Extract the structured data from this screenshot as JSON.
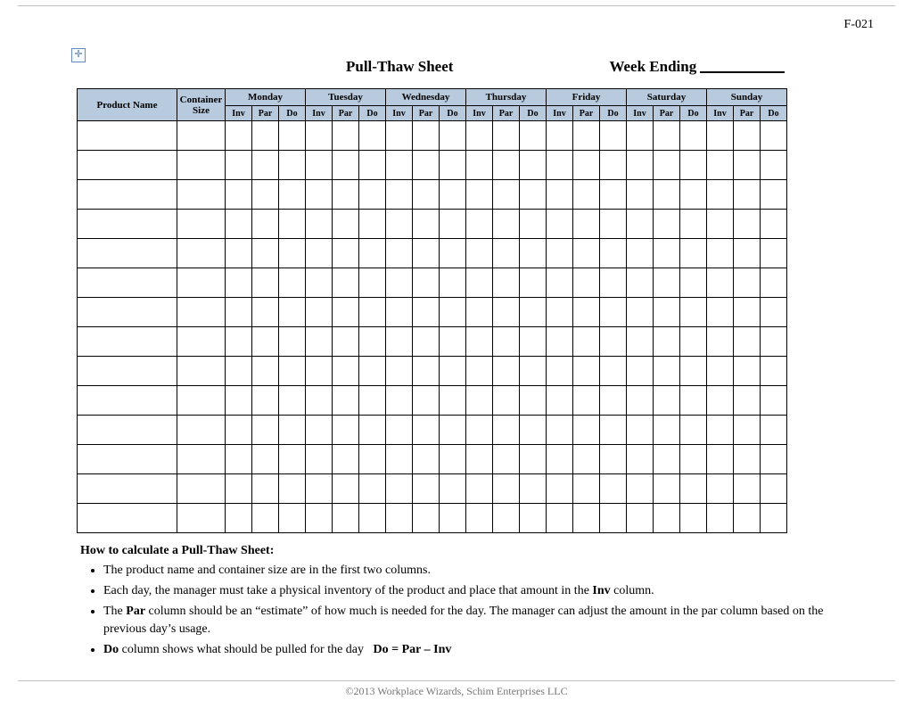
{
  "meta": {
    "form_id": "F-021"
  },
  "header": {
    "title": "Pull-Thaw Sheet",
    "week_ending_label": "Week Ending"
  },
  "table": {
    "product_name": "Product Name",
    "container_size": "Container\nSize",
    "days": [
      "Monday",
      "Tuesday",
      "Wednesday",
      "Thursday",
      "Friday",
      "Saturday",
      "Sunday"
    ],
    "sub": [
      "Inv",
      "Par",
      "Do"
    ],
    "rows": 14
  },
  "instructions": {
    "heading": "How to calculate a Pull-Thaw Sheet:",
    "items": [
      "The product name and container size are in the first two columns.",
      "Each day, the manager must take a physical inventory of the product and place that amount in the <b>Inv</b> column.",
      "The <b>Par</b> column should be an “estimate” of how much is needed for the day. The manager can adjust the amount in the par column based on the previous day’s usage.",
      "<b>Do</b> column shows what should be pulled for the day &nbsp; <b>Do = Par – Inv</b>"
    ]
  },
  "footer": {
    "copyright": "©2013 Workplace Wizards, Schim Enterprises LLC"
  }
}
